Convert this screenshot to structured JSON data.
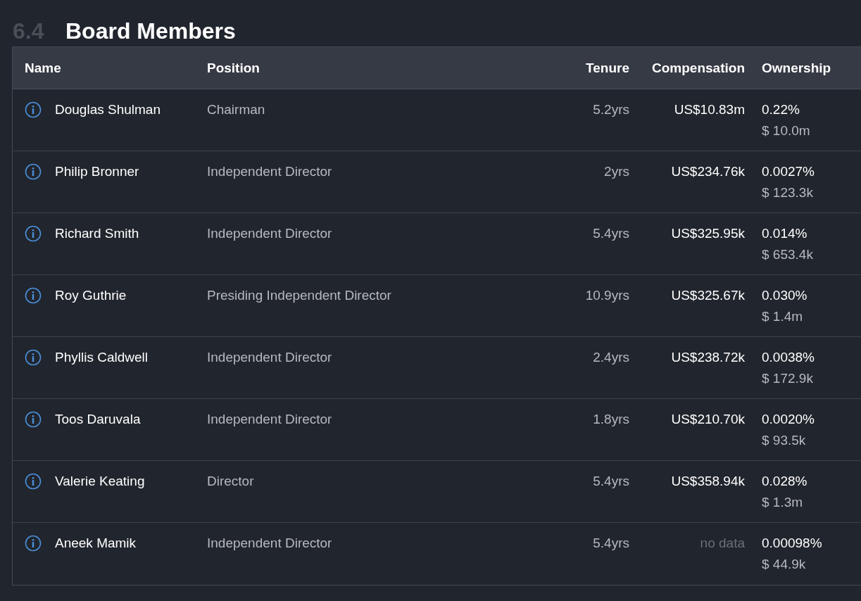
{
  "section": {
    "number": "6.4",
    "title": "Board Members"
  },
  "table": {
    "columns": [
      "Name",
      "Position",
      "Tenure",
      "Compensation",
      "Ownership"
    ],
    "rows": [
      {
        "name": "Douglas Shulman",
        "position": "Chairman",
        "tenure": "5.2yrs",
        "compensation": "US$10.83m",
        "compensation_available": true,
        "ownership_percent": "0.22%",
        "ownership_value": "$ 10.0m"
      },
      {
        "name": "Philip Bronner",
        "position": "Independent Director",
        "tenure": "2yrs",
        "compensation": "US$234.76k",
        "compensation_available": true,
        "ownership_percent": "0.0027%",
        "ownership_value": "$ 123.3k"
      },
      {
        "name": "Richard Smith",
        "position": "Independent Director",
        "tenure": "5.4yrs",
        "compensation": "US$325.95k",
        "compensation_available": true,
        "ownership_percent": "0.014%",
        "ownership_value": "$ 653.4k"
      },
      {
        "name": "Roy Guthrie",
        "position": "Presiding Independent Director",
        "tenure": "10.9yrs",
        "compensation": "US$325.67k",
        "compensation_available": true,
        "ownership_percent": "0.030%",
        "ownership_value": "$ 1.4m"
      },
      {
        "name": "Phyllis Caldwell",
        "position": "Independent Director",
        "tenure": "2.4yrs",
        "compensation": "US$238.72k",
        "compensation_available": true,
        "ownership_percent": "0.0038%",
        "ownership_value": "$ 172.9k"
      },
      {
        "name": "Toos Daruvala",
        "position": "Independent Director",
        "tenure": "1.8yrs",
        "compensation": "US$210.70k",
        "compensation_available": true,
        "ownership_percent": "0.0020%",
        "ownership_value": "$ 93.5k"
      },
      {
        "name": "Valerie Keating",
        "position": "Director",
        "tenure": "5.4yrs",
        "compensation": "US$358.94k",
        "compensation_available": true,
        "ownership_percent": "0.028%",
        "ownership_value": "$ 1.3m"
      },
      {
        "name": "Aneek Mamik",
        "position": "Independent Director",
        "tenure": "5.4yrs",
        "compensation": "no data",
        "compensation_available": false,
        "ownership_percent": "0.00098%",
        "ownership_value": "$ 44.9k"
      }
    ]
  }
}
